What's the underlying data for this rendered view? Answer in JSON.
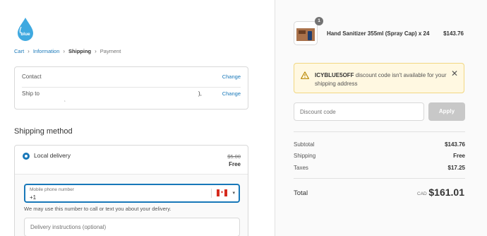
{
  "brand": {
    "logo_text": "icy blue"
  },
  "breadcrumb": {
    "cart": "Cart",
    "information": "Information",
    "shipping": "Shipping",
    "payment": "Payment"
  },
  "review": {
    "contact_label": "Contact",
    "contact_change": "Change",
    "ship_to_label": "Ship to",
    "ship_to_value": "),",
    "ship_to_change": "Change"
  },
  "shipping_method": {
    "title": "Shipping method",
    "option_name": "Local delivery",
    "price_original": "$5.00",
    "price_current": "Free",
    "phone_label": "Mobile phone number",
    "phone_value": "+1",
    "help_text": "We may use this number to call or text you about your delivery.",
    "instructions_placeholder": "Delivery instructions (optional)"
  },
  "order": {
    "quantity": "1",
    "product_name": "Hand Sanitizer 355ml (Spray Cap) x 24",
    "product_price": "$143.76"
  },
  "alert": {
    "code": "ICYBLUE5OFF",
    "message": " discount code isn't available for your shipping address",
    "color": "#fff8e1"
  },
  "discount": {
    "placeholder": "Discount code",
    "apply_label": "Apply"
  },
  "summary": {
    "subtotal_label": "Subtotal",
    "subtotal_value": "$143.76",
    "shipping_label": "Shipping",
    "shipping_value": "Free",
    "taxes_label": "Taxes",
    "taxes_value": "$17.25",
    "total_label": "Total",
    "currency": "CAD",
    "total_value": "$161.01"
  },
  "colors": {
    "accent": "#1878b9",
    "sidebar_bg": "#fafafa"
  }
}
